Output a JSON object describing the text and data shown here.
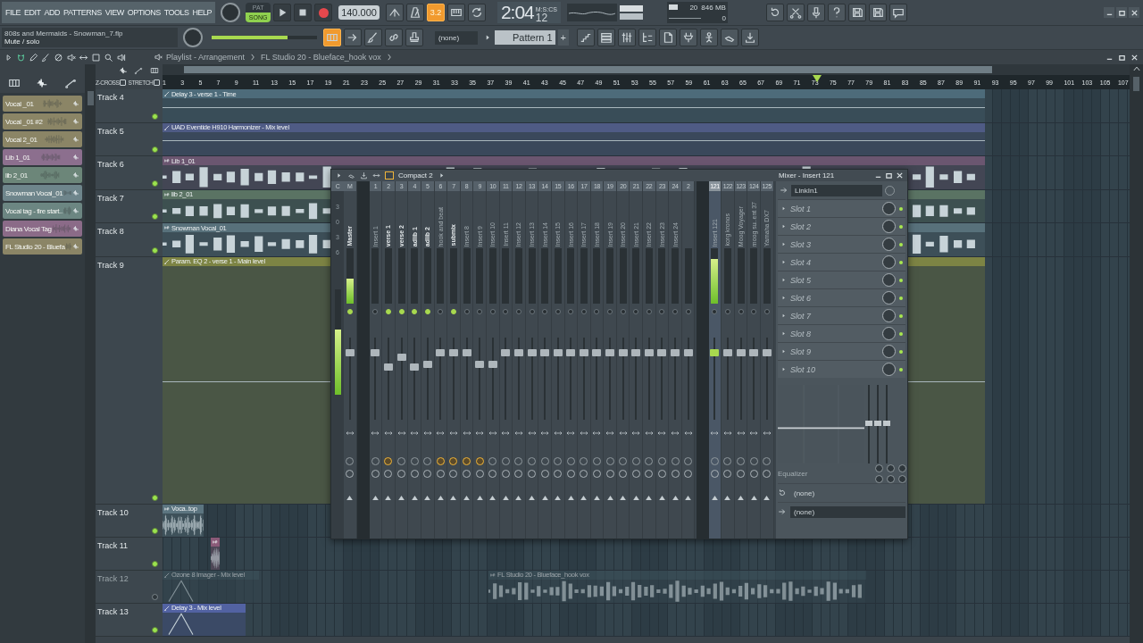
{
  "menu": [
    "FILE",
    "EDIT",
    "ADD",
    "PATTERNS",
    "VIEW",
    "OPTIONS",
    "TOOLS",
    "HELP"
  ],
  "hint": {
    "title": "808s and Mermaids - Snowman_7.flp",
    "text": "Mute / solo"
  },
  "transport": {
    "modes": [
      {
        "label": "PAT",
        "selected": false
      },
      {
        "label": "SONG",
        "selected": true
      }
    ],
    "tempo": "140.000",
    "countdown": {
      "label": "3.2",
      "on": true
    },
    "typing_keyboard": {
      "on": true
    },
    "master_pitch": {
      "level": 0.72
    }
  },
  "clock": {
    "time": "2:04",
    "unit": "M:S:CS",
    "fraction": "12"
  },
  "cpu": {
    "polyphony": "20",
    "memory": "846 MB",
    "voices": "0"
  },
  "pattern": {
    "snap": "(none)",
    "name": "Pattern 1",
    "add": "+"
  },
  "breadcrumb": [
    "Playlist - Arrangement",
    "FL Studio 20 - Blueface_hook vox"
  ],
  "picker": [
    {
      "label": "Vocal _01",
      "color": "#8b8566"
    },
    {
      "label": "Vocal _01 #2",
      "color": "#8b8566"
    },
    {
      "label": "Vocal 2_01",
      "color": "#8b8566"
    },
    {
      "label": "Lib 1_01",
      "color": "#8c6f8e"
    },
    {
      "label": "lib 2_01",
      "color": "#6c8679"
    },
    {
      "label": "Snowman Vocal_01",
      "color": "#6e858b"
    },
    {
      "label": "Vocal tag - fire start..",
      "color": "#6c8682"
    },
    {
      "label": "Diana Vocal Tag",
      "color": "#8b6b88"
    },
    {
      "label": "FL Studio 20 - Bluefa",
      "color": "#8b8566"
    }
  ],
  "playlist_options": [
    {
      "label": "Z-CROSS",
      "checked": false
    },
    {
      "label": "STRETCH",
      "checked": false
    }
  ],
  "ruler": [
    "1",
    "3",
    "5",
    "7",
    "9",
    "11",
    "13",
    "15",
    "17",
    "19",
    "21",
    "23",
    "25",
    "27",
    "29",
    "31",
    "33",
    "35",
    "37",
    "39",
    "41",
    "43",
    "45",
    "47",
    "49",
    "51",
    "53",
    "55",
    "57",
    "59",
    "61",
    "63",
    "65",
    "67",
    "69",
    "71",
    "73",
    "75",
    "77",
    "79",
    "81",
    "83",
    "85",
    "87",
    "89",
    "91",
    "93",
    "95",
    "97",
    "99",
    "101",
    "103",
    "105",
    "107"
  ],
  "tracks": [
    {
      "name": "Track 4",
      "enabled": true,
      "clips": [
        {
          "label": "Delay 3 - verse 1 - Time",
          "kind": "automation",
          "color": "#4d6b7a"
        }
      ]
    },
    {
      "name": "Track 5",
      "enabled": true,
      "clips": [
        {
          "label": "UAD Eventide H910 Harmonizer - Mix level",
          "kind": "automation",
          "color": "#4f5b85"
        }
      ]
    },
    {
      "name": "Track 6",
      "enabled": true,
      "clips": [
        {
          "label": "Lib 1_01",
          "kind": "audio",
          "color": "#6b5670"
        }
      ]
    },
    {
      "name": "Track 7",
      "enabled": true,
      "clips": [
        {
          "label": "lib 2_01",
          "kind": "audio",
          "color": "#5a7363"
        }
      ]
    },
    {
      "name": "Track 8",
      "enabled": true,
      "clips": [
        {
          "label": "Snowman Vocal_01",
          "kind": "audio",
          "color": "#58717b"
        }
      ]
    },
    {
      "name": "Track 9",
      "enabled": true,
      "clips": [
        {
          "label": "Param. EQ 2 - verse 1 - Main level",
          "kind": "automation",
          "color": "#7d8444"
        }
      ]
    },
    {
      "name": "Track 10",
      "enabled": true,
      "clips": [
        {
          "label": "Voca..top",
          "kind": "audio",
          "color": "#5c7580"
        }
      ]
    },
    {
      "name": "Track 11",
      "enabled": true,
      "clips": [
        {
          "kind": "audio",
          "color": "#8a5a78"
        }
      ]
    },
    {
      "name": "Track 12",
      "enabled": false,
      "clips": [
        {
          "label": "Ozone 8 Imager - Mix level",
          "kind": "automation",
          "color": "#3d525c"
        },
        {
          "label": "FL Studio 20 - Blueface_hook vox",
          "kind": "audio",
          "color": "#3d525c"
        }
      ]
    },
    {
      "name": "Track 13",
      "enabled": true,
      "clips": [
        {
          "label": "Delay 3 - Mix level",
          "kind": "automation",
          "color": "#5262a2"
        }
      ]
    }
  ],
  "mixer": {
    "title": "Compact 2",
    "current": {
      "number": "C",
      "scale": [
        "3",
        "0",
        "3",
        "6"
      ],
      "meter": {
        "level": 0.62
      }
    },
    "strips": [
      {
        "number": "M",
        "name": "Master",
        "routed": true,
        "send": false,
        "selected": false,
        "level": 0.81,
        "meter": {
          "level": 0.45
        }
      },
      {
        "number": "1",
        "name": "Insert 1",
        "routed": false,
        "send": false,
        "selected": false,
        "level": 0.81
      },
      {
        "number": "2",
        "name": "verse 1",
        "routed": true,
        "send": true,
        "selected": false,
        "level": 0.64
      },
      {
        "number": "3",
        "name": "verse 2",
        "routed": true,
        "send": false,
        "selected": false,
        "level": 0.76
      },
      {
        "number": "4",
        "name": "adlib 1",
        "routed": true,
        "send": false,
        "selected": false,
        "level": 0.64
      },
      {
        "number": "5",
        "name": "adlib 2",
        "routed": true,
        "send": false,
        "selected": false,
        "level": 0.67
      },
      {
        "number": "6",
        "name": "hook and beat",
        "routed": false,
        "send": true,
        "selected": false,
        "level": 0.81
      },
      {
        "number": "7",
        "name": "submix",
        "routed": true,
        "send": true,
        "selected": false,
        "level": 0.81
      },
      {
        "number": "8",
        "name": "Insert 8",
        "routed": false,
        "send": true,
        "selected": false,
        "level": 0.81
      },
      {
        "number": "9",
        "name": "Insert 9",
        "routed": false,
        "send": true,
        "selected": false,
        "level": 0.67
      },
      {
        "number": "10",
        "name": "Insert 10",
        "routed": false,
        "send": false,
        "selected": false,
        "level": 0.67
      },
      {
        "number": "11",
        "name": "Insert 11",
        "routed": false,
        "send": false,
        "selected": false,
        "level": 0.81
      },
      {
        "number": "12",
        "name": "Insert 12",
        "routed": false,
        "send": false,
        "selected": false,
        "level": 0.81
      },
      {
        "number": "13",
        "name": "Insert 13",
        "routed": false,
        "send": false,
        "selected": false,
        "level": 0.81
      },
      {
        "number": "14",
        "name": "Insert 14",
        "routed": false,
        "send": false,
        "selected": false,
        "level": 0.81
      },
      {
        "number": "15",
        "name": "Insert 15",
        "routed": false,
        "send": false,
        "selected": false,
        "level": 0.81
      },
      {
        "number": "16",
        "name": "Insert 16",
        "routed": false,
        "send": false,
        "selected": false,
        "level": 0.81
      },
      {
        "number": "17",
        "name": "Insert 17",
        "routed": false,
        "send": false,
        "selected": false,
        "level": 0.81
      },
      {
        "number": "18",
        "name": "Insert 18",
        "routed": false,
        "send": false,
        "selected": false,
        "level": 0.81
      },
      {
        "number": "19",
        "name": "Insert 19",
        "routed": false,
        "send": false,
        "selected": false,
        "level": 0.81
      },
      {
        "number": "20",
        "name": "Insert 20",
        "routed": false,
        "send": false,
        "selected": false,
        "level": 0.81
      },
      {
        "number": "21",
        "name": "Insert 21",
        "routed": false,
        "send": false,
        "selected": false,
        "level": 0.81
      },
      {
        "number": "22",
        "name": "Insert 22",
        "routed": false,
        "send": false,
        "selected": false,
        "level": 0.81
      },
      {
        "number": "23",
        "name": "Insert 23",
        "routed": false,
        "send": false,
        "selected": false,
        "level": 0.81
      },
      {
        "number": "24",
        "name": "Insert 24",
        "routed": false,
        "send": false,
        "selected": false,
        "level": 0.81
      },
      {
        "number": "2",
        "routed": false,
        "send": false,
        "selected": false,
        "level": 0.81
      }
    ],
    "far_strips": [
      {
        "number": "121",
        "name": "Insert 121",
        "routed": false,
        "send": false,
        "selected": true,
        "level": 0.81,
        "meter": {
          "level": 0.8
        }
      },
      {
        "number": "122",
        "name": "korg kronos",
        "routed": false,
        "send": false,
        "selected": false,
        "level": 0.81
      },
      {
        "number": "123",
        "name": "Moog Voyager",
        "routed": false,
        "send": false,
        "selected": false,
        "level": 0.81
      },
      {
        "number": "124",
        "name": "moog su..ent 37",
        "routed": false,
        "send": false,
        "selected": false,
        "level": 0.81
      },
      {
        "number": "125",
        "name": "Yamaha DX7",
        "routed": false,
        "send": false,
        "selected": false,
        "level": 0.81
      }
    ],
    "insert": {
      "title": "Mixer - Insert 121",
      "input": "LinkIn1",
      "slots": [
        {
          "label": "Slot 1",
          "on": true
        },
        {
          "label": "Slot 2",
          "on": true
        },
        {
          "label": "Slot 3",
          "on": true
        },
        {
          "label": "Slot 4",
          "on": true
        },
        {
          "label": "Slot 5",
          "on": true
        },
        {
          "label": "Slot 6",
          "on": true
        },
        {
          "label": "Slot 7",
          "on": true
        },
        {
          "label": "Slot 8",
          "on": true
        },
        {
          "label": "Slot 9",
          "on": true
        },
        {
          "label": "Slot 10",
          "on": true
        }
      ],
      "eq_label": "Equalizer",
      "outputs": [
        "(none)",
        "(none)"
      ]
    }
  }
}
